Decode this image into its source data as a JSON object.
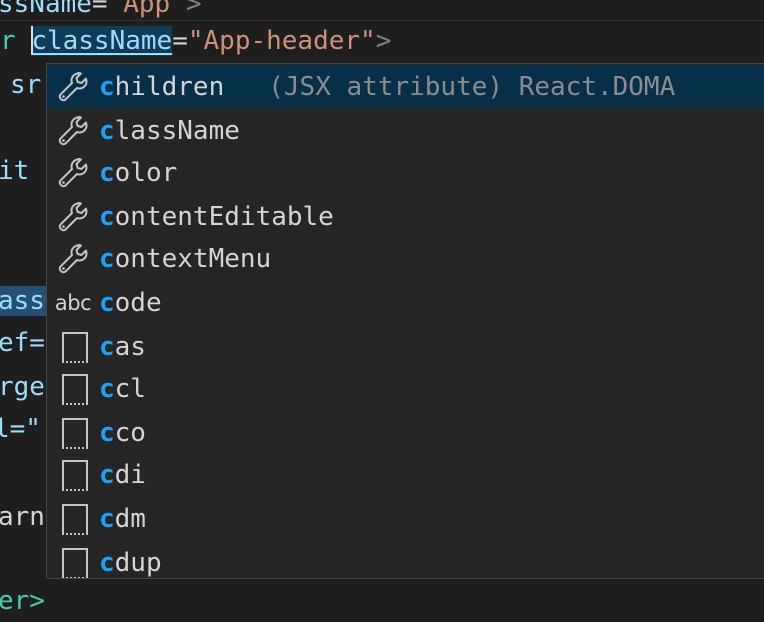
{
  "editor": {
    "line0": {
      "attr": "ssName",
      "eq": "=",
      "str": "\"App\"",
      "close": ">"
    },
    "line1": {
      "tag": "r",
      "attr": "className",
      "eq": "=",
      "str": "\"App-header\"",
      "close": ">"
    },
    "left_fragments": [
      "sr",
      "it",
      "ass",
      "ef=",
      "rge",
      "l=\"",
      "arn",
      "er>"
    ]
  },
  "suggest": {
    "items": [
      {
        "icon": "wrench",
        "match": "c",
        "rest": "hildren",
        "detail": "(JSX attribute) React.DOMA",
        "selected": true
      },
      {
        "icon": "wrench",
        "match": "c",
        "rest": "lassName"
      },
      {
        "icon": "wrench",
        "match": "c",
        "rest": "olor"
      },
      {
        "icon": "wrench",
        "match": "c",
        "rest": "ontentEditable"
      },
      {
        "icon": "wrench",
        "match": "c",
        "rest": "ontextMenu"
      },
      {
        "icon": "abc",
        "icon_text": "abc",
        "match": "c",
        "rest": "ode"
      },
      {
        "icon": "snippet",
        "match": "c",
        "rest": "as"
      },
      {
        "icon": "snippet",
        "match": "c",
        "rest": "cl"
      },
      {
        "icon": "snippet",
        "match": "c",
        "rest": "co"
      },
      {
        "icon": "snippet",
        "match": "c",
        "rest": "di"
      },
      {
        "icon": "snippet",
        "match": "c",
        "rest": "dm"
      },
      {
        "icon": "snippet",
        "match": "c",
        "rest": "dup"
      }
    ]
  }
}
